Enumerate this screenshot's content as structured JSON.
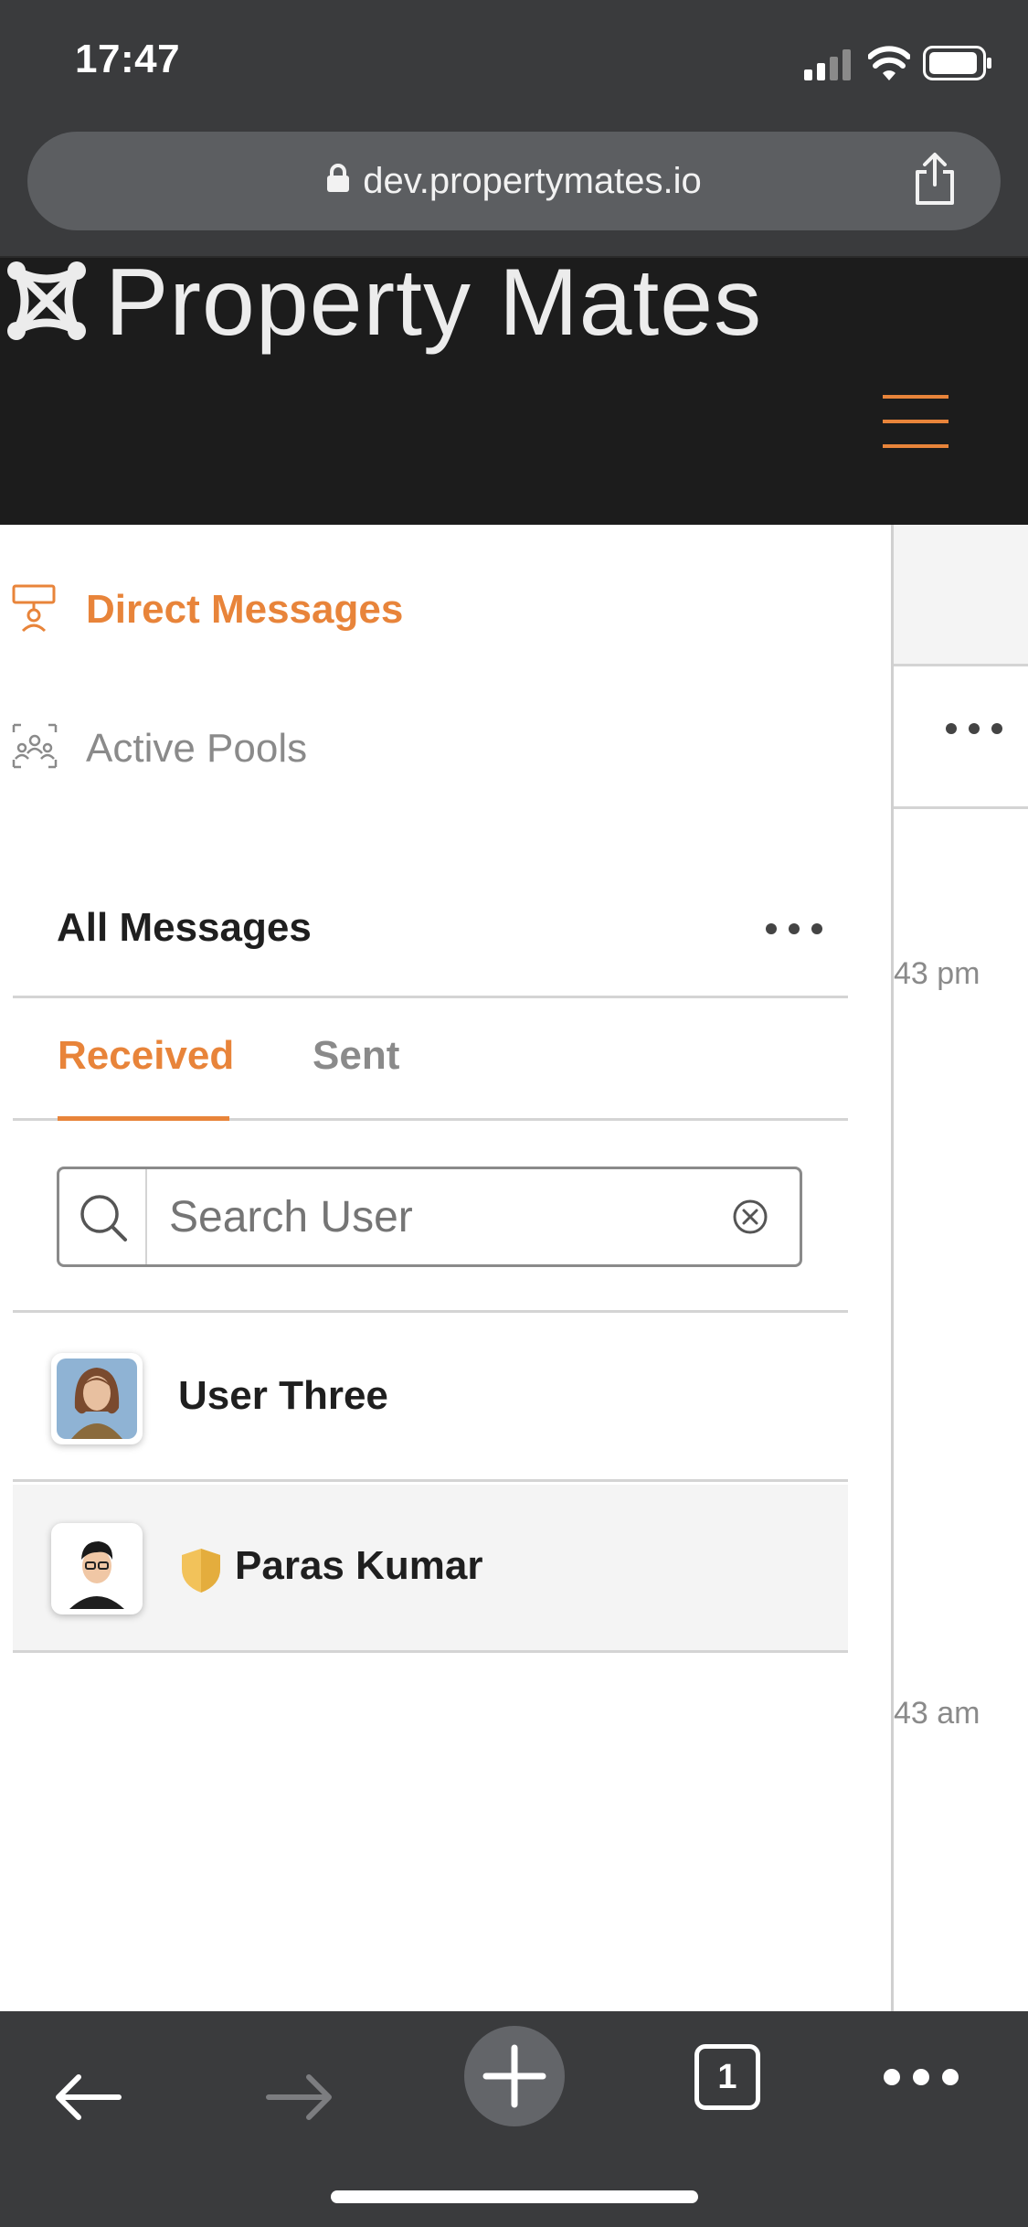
{
  "status_bar": {
    "time": "17:47"
  },
  "browser": {
    "url": "dev.propertymates.io",
    "tab_count": "1"
  },
  "site": {
    "brand_name": "Property Mates",
    "accent_color": "#e8843a"
  },
  "sidebar": {
    "nav_items": [
      {
        "label": "Direct Messages",
        "icon": "message-icon",
        "active": true
      },
      {
        "label": "Active Pools",
        "icon": "group-icon",
        "active": false
      }
    ],
    "messages_title": "All Messages",
    "tabs": [
      {
        "label": "Received",
        "active": true
      },
      {
        "label": "Sent",
        "active": false
      }
    ],
    "search": {
      "placeholder": "Search User",
      "value": ""
    },
    "users": [
      {
        "name": "User Three",
        "verified": false,
        "avatar": "woman-avatar"
      },
      {
        "name": "Paras Kumar",
        "verified": true,
        "avatar": "man-avatar"
      }
    ]
  },
  "right_panel": {
    "timestamps": [
      "43 pm",
      "43 am"
    ]
  }
}
